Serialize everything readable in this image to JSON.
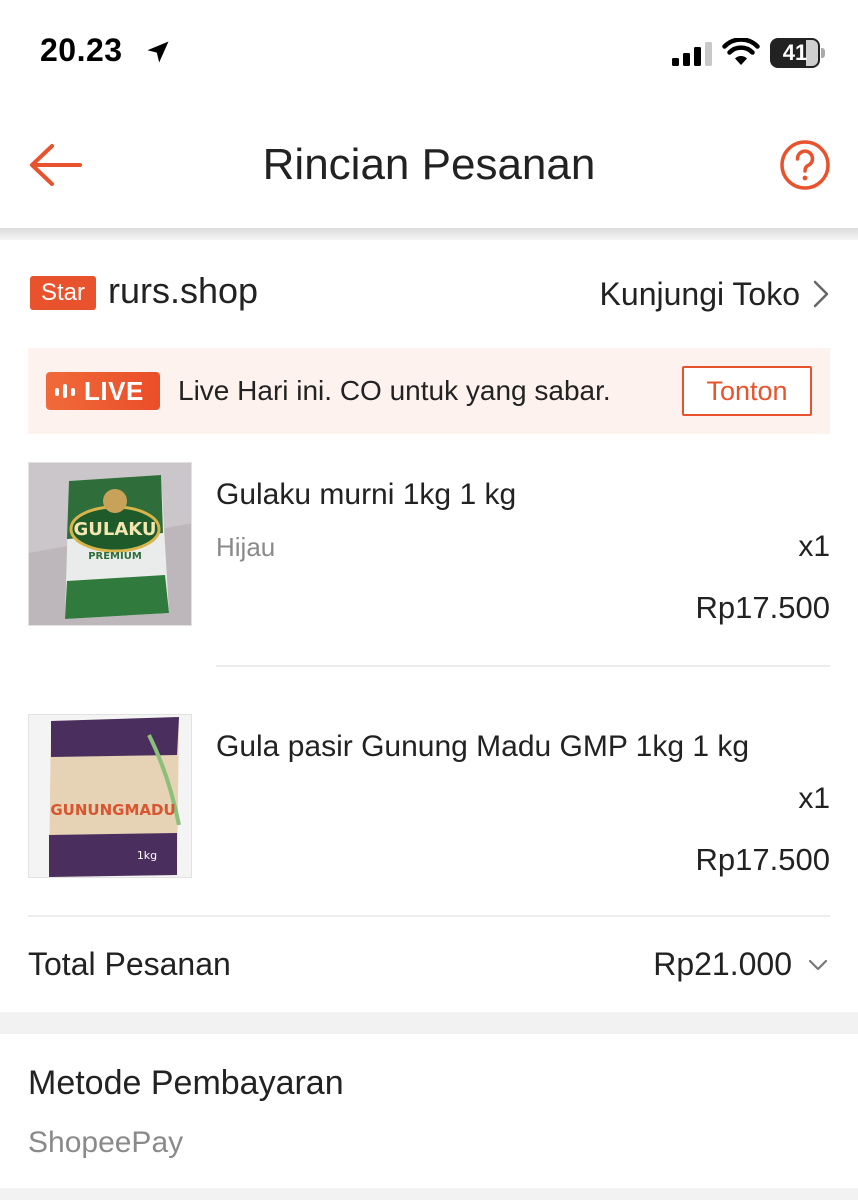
{
  "status_bar": {
    "time": "20.23",
    "battery": "41"
  },
  "header": {
    "title": "Rincian Pesanan"
  },
  "shop": {
    "badge": "Star",
    "name": "rurs.shop",
    "visit_label": "Kunjungi Toko"
  },
  "live_banner": {
    "badge": "LIVE",
    "caption": "Live Hari ini. CO untuk yang sabar.",
    "watch_label": "Tonton"
  },
  "products": [
    {
      "name": "Gulaku murni 1kg 1 kg",
      "variant": "Hijau",
      "qty": "x1",
      "price": "Rp17.500",
      "thumb_label": "GULAKU",
      "thumb_sub": "PREMIUM"
    },
    {
      "name": "Gula pasir Gunung Madu GMP 1kg 1 kg",
      "variant": "",
      "qty": "x1",
      "price": "Rp17.500",
      "thumb_label": "GUNUNGMADU",
      "thumb_sub": "1kg"
    }
  ],
  "total": {
    "label": "Total Pesanan",
    "value": "Rp21.000"
  },
  "payment": {
    "title": "Metode Pembayaran",
    "method": "ShopeePay"
  },
  "colors": {
    "accent": "#e8532e",
    "banner_bg": "#fdf2ee",
    "muted_text": "#8a8a8a"
  },
  "icons": [
    "location-arrow-icon",
    "signal-icon",
    "wifi-icon",
    "battery-icon",
    "back-arrow-icon",
    "help-icon",
    "chevron-right-icon",
    "live-bars-icon",
    "chevron-down-icon"
  ]
}
